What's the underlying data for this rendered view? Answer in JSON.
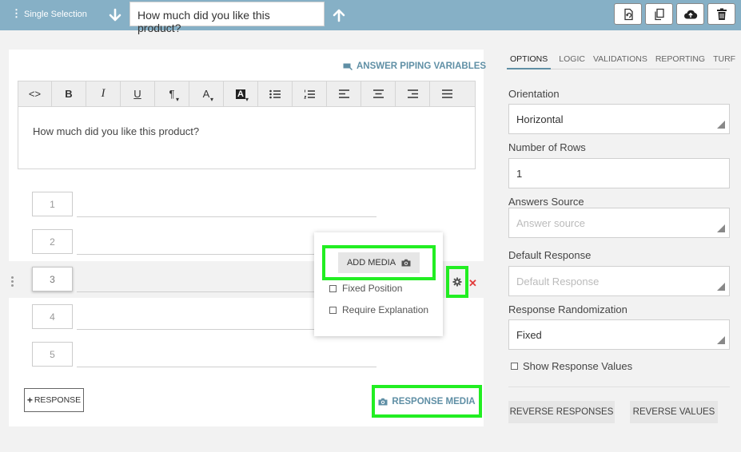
{
  "header": {
    "question_type": "Single Selection",
    "question_title": "How much did you like this product?",
    "tool_icons": [
      "refresh-doc-icon",
      "copy-icon",
      "cloud-upload-icon",
      "trash-icon"
    ]
  },
  "editor": {
    "piping_link": "ANSWER PIPING VARIABLES",
    "toolbar": {
      "code": "<>",
      "bold": "B",
      "italic": "I",
      "underline": "U",
      "paragraph": "¶",
      "font_color": "A",
      "bg_color": "A"
    },
    "content": "How much did you like this product?"
  },
  "responses": [
    "1",
    "2",
    "3",
    "4",
    "5"
  ],
  "add_response_label": "RESPONSE",
  "response_media_label": "RESPONSE MEDIA",
  "popup": {
    "add_media_label": "ADD MEDIA",
    "fixed_position_label": "Fixed Position",
    "require_explanation_label": "Require Explanation"
  },
  "panel": {
    "tabs": [
      "OPTIONS",
      "LOGIC",
      "VALIDATIONS",
      "REPORTING",
      "TURF"
    ],
    "active_tab": "OPTIONS",
    "orientation_label": "Orientation",
    "orientation_value": "Horizontal",
    "rows_label": "Number of Rows",
    "rows_value": "1",
    "answers_source_label": "Answers Source",
    "answers_source_placeholder": "Answer source",
    "default_response_label": "Default Response",
    "default_response_placeholder": "Default Response",
    "randomization_label": "Response Randomization",
    "randomization_value": "Fixed",
    "show_values_label": "Show Response Values",
    "reverse_responses_label": "REVERSE RESPONSES",
    "reverse_values_label": "REVERSE VALUES"
  },
  "colors": {
    "header_bg": "#86b0c6",
    "accent": "#5f8fa5",
    "highlight": "#22ee22",
    "delete": "#e23c3c"
  }
}
